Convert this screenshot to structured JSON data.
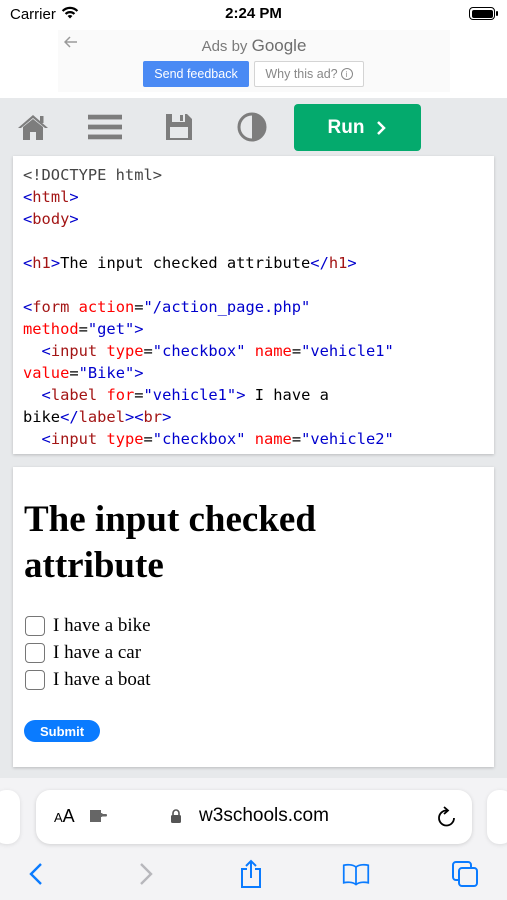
{
  "status_bar": {
    "carrier": "Carrier",
    "time": "2:24 PM"
  },
  "ad": {
    "ads_by": "Ads by",
    "google": "Google",
    "send_feedback": "Send feedback",
    "why_this_ad": "Why this ad?",
    "info_glyph": "i"
  },
  "toolbar": {
    "run_label": "Run"
  },
  "code_lines": [
    [
      {
        "c": "dt",
        "t": "<!DOCTYPE html>"
      }
    ],
    [
      {
        "c": "tagb",
        "t": "<"
      },
      {
        "c": "tag",
        "t": "html"
      },
      {
        "c": "tagb",
        "t": ">"
      }
    ],
    [
      {
        "c": "tagb",
        "t": "<"
      },
      {
        "c": "tag",
        "t": "body"
      },
      {
        "c": "tagb",
        "t": ">"
      }
    ],
    [],
    [
      {
        "c": "tagb",
        "t": "<"
      },
      {
        "c": "tag",
        "t": "h1"
      },
      {
        "c": "tagb",
        "t": ">"
      },
      {
        "c": "plain",
        "t": "The input checked attribute"
      },
      {
        "c": "tagb",
        "t": "</"
      },
      {
        "c": "tag",
        "t": "h1"
      },
      {
        "c": "tagb",
        "t": ">"
      }
    ],
    [],
    [
      {
        "c": "tagb",
        "t": "<"
      },
      {
        "c": "tag",
        "t": "form"
      },
      {
        "c": "attr",
        "t": " action"
      },
      {
        "c": "plain",
        "t": "="
      },
      {
        "c": "val",
        "t": "\"/action_page.php\""
      }
    ],
    [
      {
        "c": "attr",
        "t": "method"
      },
      {
        "c": "plain",
        "t": "="
      },
      {
        "c": "val",
        "t": "\"get\""
      },
      {
        "c": "tagb",
        "t": ">"
      }
    ],
    [
      {
        "c": "plain",
        "t": "  "
      },
      {
        "c": "tagb",
        "t": "<"
      },
      {
        "c": "tag",
        "t": "input"
      },
      {
        "c": "attr",
        "t": " type"
      },
      {
        "c": "plain",
        "t": "="
      },
      {
        "c": "val",
        "t": "\"checkbox\""
      },
      {
        "c": "attr",
        "t": " name"
      },
      {
        "c": "plain",
        "t": "="
      },
      {
        "c": "val",
        "t": "\"vehicle1\""
      }
    ],
    [
      {
        "c": "attr",
        "t": "value"
      },
      {
        "c": "plain",
        "t": "="
      },
      {
        "c": "val",
        "t": "\"Bike\""
      },
      {
        "c": "tagb",
        "t": ">"
      }
    ],
    [
      {
        "c": "plain",
        "t": "  "
      },
      {
        "c": "tagb",
        "t": "<"
      },
      {
        "c": "tag",
        "t": "label"
      },
      {
        "c": "attr",
        "t": " for"
      },
      {
        "c": "plain",
        "t": "="
      },
      {
        "c": "val",
        "t": "\"vehicle1\""
      },
      {
        "c": "tagb",
        "t": ">"
      },
      {
        "c": "plain",
        "t": " I have a"
      }
    ],
    [
      {
        "c": "plain",
        "t": "bike"
      },
      {
        "c": "tagb",
        "t": "</"
      },
      {
        "c": "tag",
        "t": "label"
      },
      {
        "c": "tagb",
        "t": ">"
      },
      {
        "c": "tagb",
        "t": "<"
      },
      {
        "c": "tag",
        "t": "br"
      },
      {
        "c": "tagb",
        "t": ">"
      }
    ],
    [
      {
        "c": "plain",
        "t": "  "
      },
      {
        "c": "tagb",
        "t": "<"
      },
      {
        "c": "tag",
        "t": "input"
      },
      {
        "c": "attr",
        "t": " type"
      },
      {
        "c": "plain",
        "t": "="
      },
      {
        "c": "val",
        "t": "\"checkbox\""
      },
      {
        "c": "attr",
        "t": " name"
      },
      {
        "c": "plain",
        "t": "="
      },
      {
        "c": "val",
        "t": "\"vehicle2\""
      }
    ]
  ],
  "result": {
    "heading": "The input checked attribute",
    "checkboxes": [
      {
        "label": "I have a bike",
        "checked": false
      },
      {
        "label": "I have a car",
        "checked": false
      },
      {
        "label": "I have a boat",
        "checked": false
      }
    ],
    "submit_label": "Submit"
  },
  "browser": {
    "text_size": "A",
    "text_size_large": "A",
    "domain": "w3schools.com"
  },
  "colors": {
    "run_green": "#04aa6d",
    "ios_blue": "#0a7bff",
    "feedback_blue": "#4a8af4"
  }
}
